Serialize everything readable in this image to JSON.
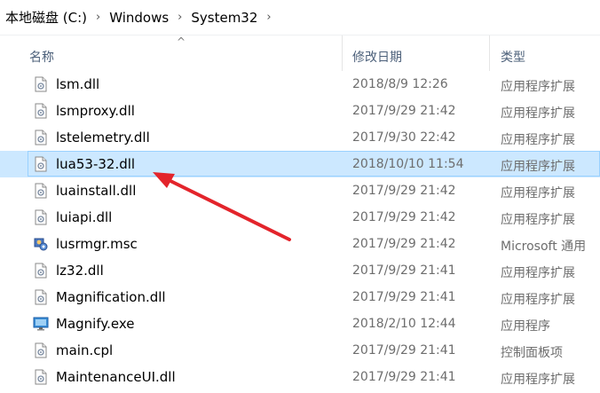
{
  "breadcrumb": {
    "items": [
      "本地磁盘 (C:)",
      "Windows",
      "System32"
    ],
    "separator": "›"
  },
  "columns": {
    "name": "名称",
    "date": "修改日期",
    "type": "类型"
  },
  "files": [
    {
      "name": "lsm.dll",
      "date": "2018/8/9 12:26",
      "type": "应用程序扩展",
      "icon": "dll-file-icon"
    },
    {
      "name": "lsmproxy.dll",
      "date": "2017/9/29 21:42",
      "type": "应用程序扩展",
      "icon": "dll-file-icon"
    },
    {
      "name": "lstelemetry.dll",
      "date": "2017/9/30 22:42",
      "type": "应用程序扩展",
      "icon": "dll-file-icon"
    },
    {
      "name": "lua53-32.dll",
      "date": "2018/10/10 11:54",
      "type": "应用程序扩展",
      "icon": "dll-file-icon",
      "selected": true
    },
    {
      "name": "luainstall.dll",
      "date": "2017/9/29 21:42",
      "type": "应用程序扩展",
      "icon": "dll-file-icon"
    },
    {
      "name": "luiapi.dll",
      "date": "2017/9/29 21:42",
      "type": "应用程序扩展",
      "icon": "dll-file-icon"
    },
    {
      "name": "lusrmgr.msc",
      "date": "2017/9/29 21:42",
      "type": "Microsoft 通用",
      "icon": "msc-console-icon"
    },
    {
      "name": "lz32.dll",
      "date": "2017/9/29 21:41",
      "type": "应用程序扩展",
      "icon": "dll-file-icon"
    },
    {
      "name": "Magnification.dll",
      "date": "2017/9/29 21:41",
      "type": "应用程序扩展",
      "icon": "dll-file-icon"
    },
    {
      "name": "Magnify.exe",
      "date": "2018/2/10 12:44",
      "type": "应用程序",
      "icon": "magnifier-app-icon"
    },
    {
      "name": "main.cpl",
      "date": "2017/9/29 21:41",
      "type": "控制面板项",
      "icon": "dll-file-icon"
    },
    {
      "name": "MaintenanceUI.dll",
      "date": "2017/9/29 21:41",
      "type": "应用程序扩展",
      "icon": "dll-file-icon"
    }
  ],
  "colors": {
    "selection_bg": "#cce8ff",
    "selection_border": "#99d1ff",
    "annotation_arrow": "#e3242b"
  }
}
